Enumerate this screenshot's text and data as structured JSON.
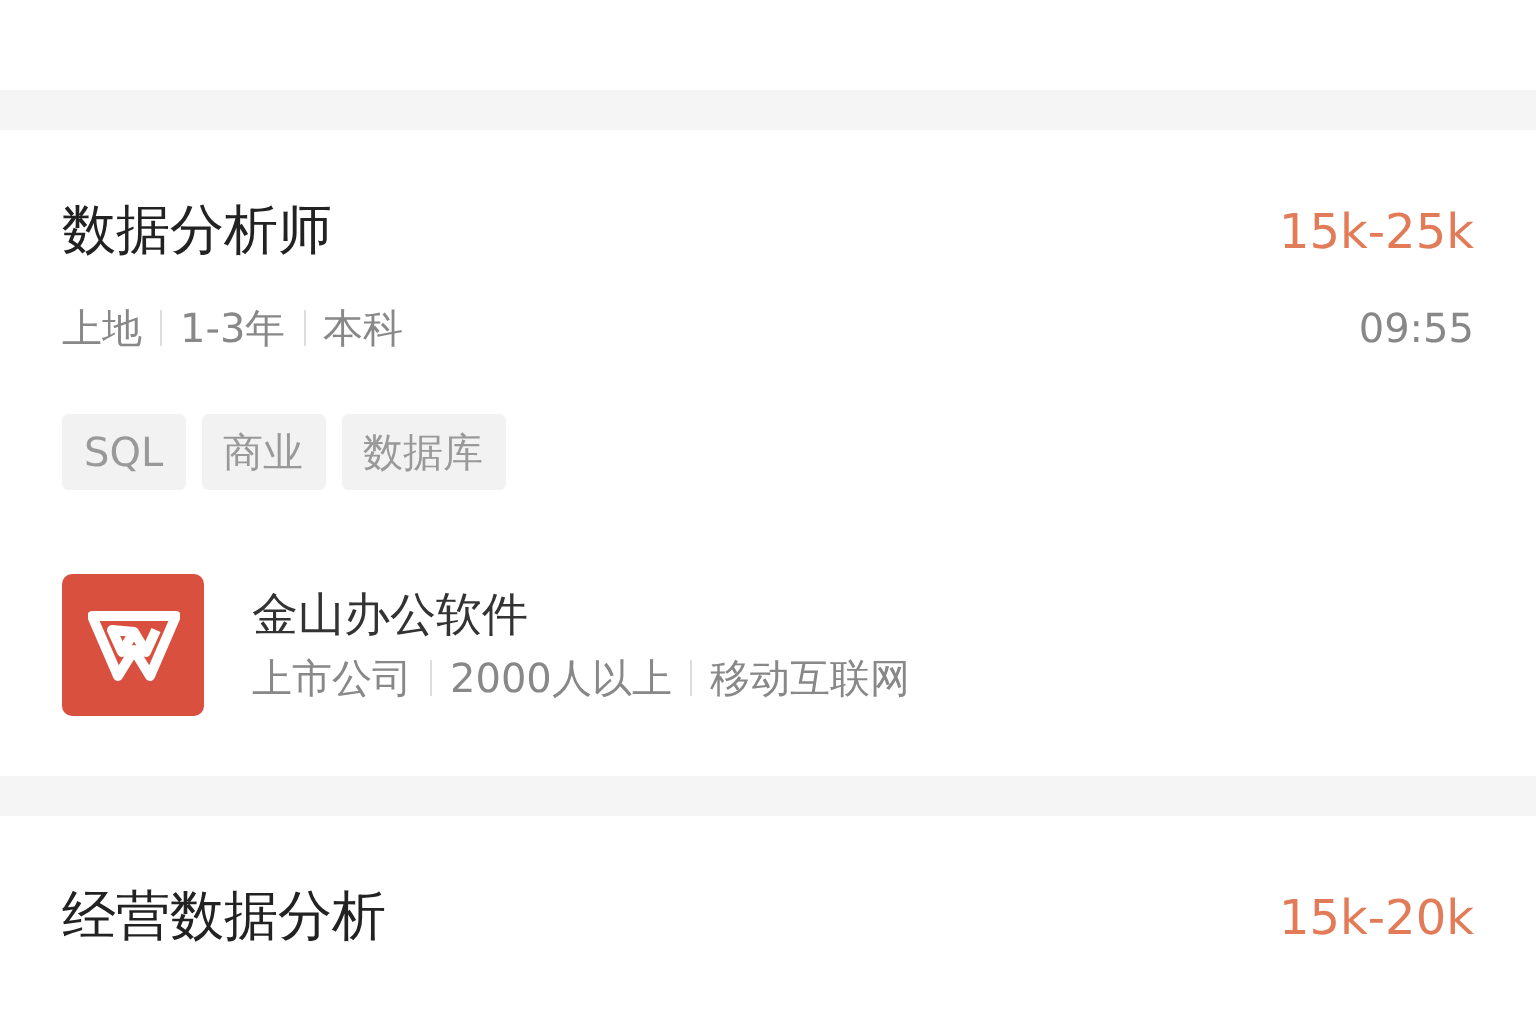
{
  "jobs": [
    {
      "title": "数据分析师",
      "salary": "15k-25k",
      "meta": [
        "上地",
        "1-3年",
        "本科"
      ],
      "time": "09:55",
      "tags": [
        "SQL",
        "商业",
        "数据库"
      ],
      "company": {
        "name": "金山办公软件",
        "meta": [
          "上市公司",
          "2000人以上",
          "移动互联网"
        ]
      }
    },
    {
      "title": "经营数据分析",
      "salary": "15k-20k"
    }
  ]
}
